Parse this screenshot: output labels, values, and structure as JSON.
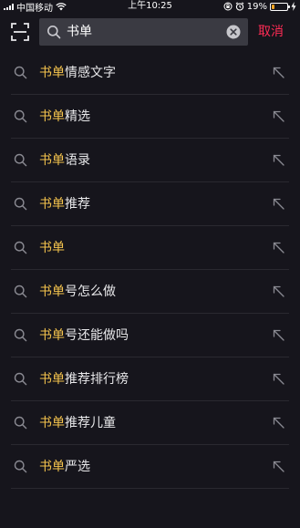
{
  "status_bar": {
    "carrier": "中国移动",
    "time": "上午10:25",
    "battery_percent": "19%",
    "battery_level": 0.19,
    "icons": [
      "signal-icon",
      "wifi-icon",
      "orientation-lock-icon",
      "alarm-icon",
      "battery-icon",
      "charging-icon"
    ]
  },
  "search": {
    "query": "书单",
    "cancel_label": "取消",
    "icons": [
      "scan-icon",
      "search-icon",
      "clear-icon"
    ]
  },
  "suggestions": [
    {
      "highlight": "书单",
      "rest": "情感文字"
    },
    {
      "highlight": "书单",
      "rest": "精选"
    },
    {
      "highlight": "书单",
      "rest": "语录"
    },
    {
      "highlight": "书单",
      "rest": "推荐"
    },
    {
      "highlight": "书单",
      "rest": ""
    },
    {
      "highlight": "书单",
      "rest": "号怎么做"
    },
    {
      "highlight": "书单",
      "rest": "号还能做吗"
    },
    {
      "highlight": "书单",
      "rest": "推荐排行榜"
    },
    {
      "highlight": "书单",
      "rest": "推荐儿童"
    },
    {
      "highlight": "书单",
      "rest": "严选"
    }
  ],
  "colors": {
    "background": "#16151c",
    "highlight": "#f4c34d",
    "cancel": "#fe2c55",
    "search_box": "#3a3a42"
  }
}
